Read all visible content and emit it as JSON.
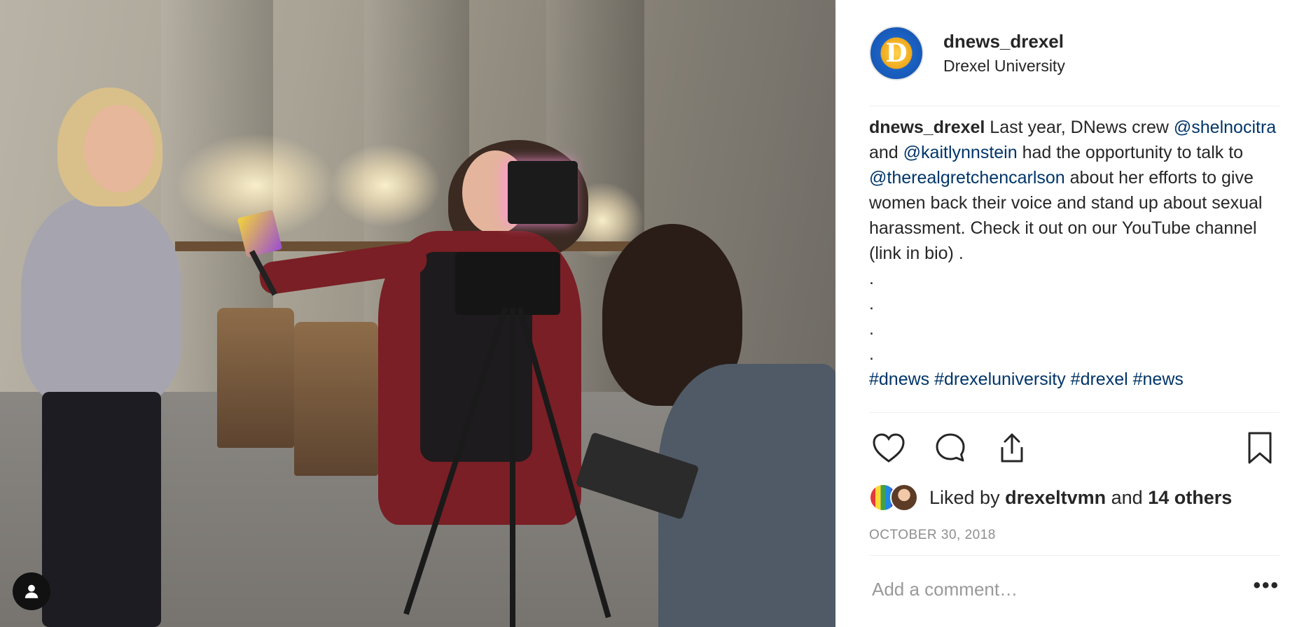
{
  "post": {
    "author": {
      "username": "dnews_drexel",
      "location": "Drexel University",
      "avatar_icon": "dnews-logo-icon",
      "avatar_letter": "D"
    },
    "caption": {
      "username": "dnews_drexel",
      "text_1": " Last year, DNews crew ",
      "mention_1": "@shelnocitra",
      "text_2": " and ",
      "mention_2": "@kaitlynnstein",
      "text_3": " had the opportunity to talk to ",
      "mention_3": "@therealgretchencarlson",
      "text_4": " about her efforts to give women back their voice and stand up about sexual harassment. Check it out on our YouTube channel (link in bio) .",
      "dots": [
        ".",
        ".",
        ".",
        "."
      ],
      "hashtags": [
        "#dnews",
        "#drexeluniversity",
        "#drexel",
        "#news"
      ]
    },
    "actions": {
      "like_icon": "heart-icon",
      "comment_icon": "comment-icon",
      "share_icon": "share-icon",
      "save_icon": "bookmark-icon"
    },
    "likes": {
      "prefix": "Liked by ",
      "first_liker": "drexeltvmn",
      "joiner": " and ",
      "others": "14 others"
    },
    "date": "OCTOBER 30, 2018",
    "comment": {
      "placeholder": "Add a comment…",
      "more_label": "•••"
    }
  },
  "colors": {
    "link": "#003569",
    "text": "#262626",
    "muted": "#8e8e8e",
    "divider": "#efefef"
  }
}
